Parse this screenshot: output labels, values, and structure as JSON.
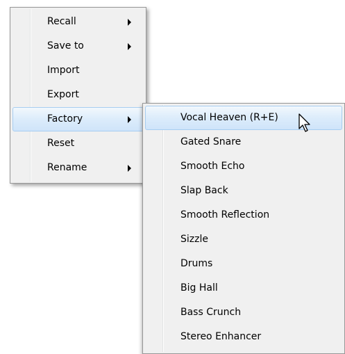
{
  "main_menu": {
    "items": [
      {
        "label": "Recall",
        "has_submenu": true
      },
      {
        "label": "Save to",
        "has_submenu": true
      },
      {
        "label": "Import",
        "has_submenu": false
      },
      {
        "label": "Export",
        "has_submenu": false
      },
      {
        "label": "Factory",
        "has_submenu": true,
        "highlighted": true
      },
      {
        "label": "Reset",
        "has_submenu": false
      },
      {
        "label": "Rename",
        "has_submenu": true
      }
    ]
  },
  "factory_submenu": {
    "items": [
      {
        "label": "Vocal Heaven (R+E)",
        "highlighted": true
      },
      {
        "label": "Gated Snare"
      },
      {
        "label": "Smooth Echo"
      },
      {
        "label": "Slap Back"
      },
      {
        "label": "Smooth Reflection"
      },
      {
        "label": "Sizzle"
      },
      {
        "label": "Drums"
      },
      {
        "label": "Big Hall"
      },
      {
        "label": "Bass Crunch"
      },
      {
        "label": "Stereo Enhancer"
      }
    ]
  },
  "colors": {
    "menu_background": "#f0f0f0",
    "menu_border": "#979797",
    "highlight_border": "#a7cdf0",
    "highlight_fill": "#dcecfb"
  },
  "icons": {
    "submenu_arrow": "triangle-right",
    "cursor": "arrow-pointer"
  }
}
